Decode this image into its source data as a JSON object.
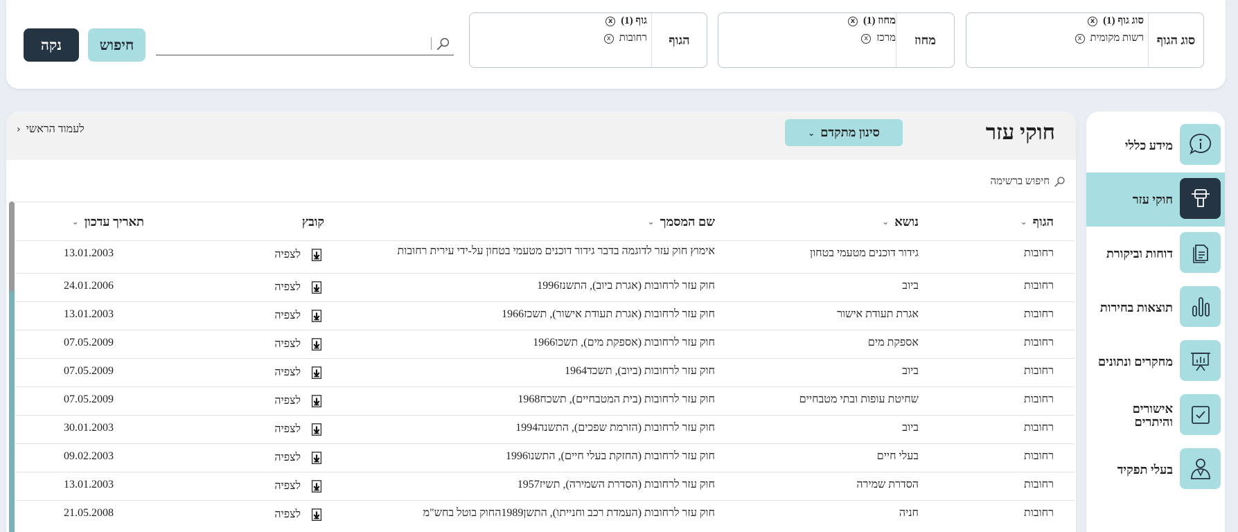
{
  "filters": [
    {
      "label": "סוג הגוף",
      "heading": "סוג גוף (1)",
      "value": "רשות מקומית"
    },
    {
      "label": "מחוז",
      "heading": "מחוז (1)",
      "value": "מרכז"
    },
    {
      "label": "הגוף",
      "heading": "גוף (1)",
      "value": "רחובות"
    }
  ],
  "search": {
    "placeholder": "",
    "search_label": "חיפוש",
    "clear_label": "נקה"
  },
  "sidebar": {
    "items": [
      {
        "label": "מידע כללי",
        "icon": "info-icon",
        "active": false
      },
      {
        "label": "חוקי עזר",
        "icon": "gavel-icon",
        "active": true
      },
      {
        "label": "דוחות וביקורת",
        "icon": "document-icon",
        "active": false
      },
      {
        "label": "תוצאות בחירות",
        "icon": "bar-chart-icon",
        "active": false
      },
      {
        "label": "מחקרים ונתונים",
        "icon": "presentation-icon",
        "active": false
      },
      {
        "label": "אישורים והיתרים",
        "icon": "checkbox-icon",
        "active": false
      },
      {
        "label": "בעלי תפקיד",
        "icon": "people-icon",
        "active": false
      }
    ]
  },
  "main": {
    "title": "חוקי עזר",
    "advanced_filter": "סינון מתקדם",
    "back_link": "לעמוד הראשי",
    "list_search": "חיפוש ברשימה"
  },
  "table": {
    "columns": [
      "הגוף",
      "נושא",
      "שם המסמך",
      "קובץ",
      "תאריך עדכון"
    ],
    "view_label": "לצפיה",
    "rows": [
      {
        "body": "רחובות",
        "topic": "גידור דוכנים מטעמי בטחון",
        "doc": "אימוץ חוק עזר לדוגמה בדבר גידור דוכנים מטעמי בטחון על-ידי עירית רחובות",
        "date": "13.01.2003"
      },
      {
        "body": "רחובות",
        "topic": "ביוב",
        "doc": "חוק עזר לרחובות (אגרת ביוב), התשנז1996",
        "date": "24.01.2006"
      },
      {
        "body": "רחובות",
        "topic": "אגרת תעודת אישור",
        "doc": "חוק עזר לרחובות (אגרת תעודת אישור), תשכז1966",
        "date": "13.01.2003"
      },
      {
        "body": "רחובות",
        "topic": "אספקת מים",
        "doc": "חוק עזר לרחובות (אספקת מים), תשכו1966",
        "date": "07.05.2009"
      },
      {
        "body": "רחובות",
        "topic": "ביוב",
        "doc": "חוק עזר לרחובות (ביוב), תשכד1964",
        "date": "07.05.2009"
      },
      {
        "body": "רחובות",
        "topic": "שחיטת עופות ובתי מטבחיים",
        "doc": "חוק עזר לרחובות (בית המטבחיים), תשכח1968",
        "date": "07.05.2009"
      },
      {
        "body": "רחובות",
        "topic": "ביוב",
        "doc": "חוק עזר לרחובות (הזרמת שפכים), התשנה1994",
        "date": "30.01.2003"
      },
      {
        "body": "רחובות",
        "topic": "בעלי חיים",
        "doc": "חוק עזר לרחובות (החזקת בעלי חיים), התשנו1996",
        "date": "09.02.2003"
      },
      {
        "body": "רחובות",
        "topic": "הסדרת שמירה",
        "doc": "חוק עזר לרחובות (הסדרת השמירה), תשיז1957",
        "date": "13.01.2003"
      },
      {
        "body": "רחובות",
        "topic": "חניה",
        "doc": "חוק עזר לרחובות (העמדת רכב וחנייתו), התשן1989החוק בוטל בחש\"מ",
        "date": "21.05.2008"
      }
    ]
  },
  "colors": {
    "accent": "#a8dde2",
    "dark": "#243442"
  }
}
